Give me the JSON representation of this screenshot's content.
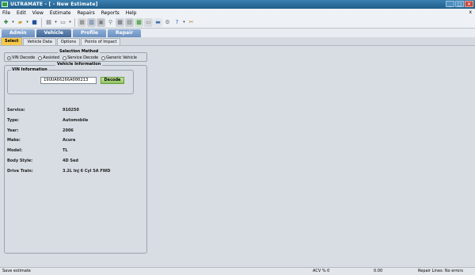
{
  "window": {
    "title": "ULTRAMATE - [ - New Estimate]",
    "min": "_",
    "max": "□",
    "close": "✕"
  },
  "menu": [
    "File",
    "Edit",
    "View",
    "Estimate",
    "Repairs",
    "Reports",
    "Help"
  ],
  "mdi_close": "x",
  "nav_tabs": [
    "Admin",
    "Vehicle",
    "Profile",
    "Repair"
  ],
  "sub_tabs": [
    "Select",
    "Vehicle Data",
    "Options",
    "Points of Impact"
  ],
  "selection_method": {
    "legend": "Selection Method",
    "options": [
      "VIN Decode",
      "Assisted",
      "Service Decode",
      "Generic Vehicle"
    ],
    "selected": "VIN Decode"
  },
  "vehicle_info": {
    "legend": "Vehicle Information",
    "vin_legend": "VIN Information",
    "vin_value": "19UUA66266A000213",
    "decode_label": "Decode",
    "fields": [
      {
        "label": "Service:",
        "value": "910250"
      },
      {
        "label": "Type:",
        "value": "Automobile"
      },
      {
        "label": "Year:",
        "value": "2006"
      },
      {
        "label": "Make:",
        "value": "Acura"
      },
      {
        "label": "Model:",
        "value": "TL"
      },
      {
        "label": "Body Style:",
        "value": "4D Sed"
      },
      {
        "label": "Drive Train:",
        "value": "3.2L Inj 6 Cyl 5A FWD"
      }
    ]
  },
  "status": {
    "left": "Save estimate",
    "acv": "ACV % 0",
    "amount": "0.00",
    "repair_lines": "Repair Lines: No errors"
  }
}
